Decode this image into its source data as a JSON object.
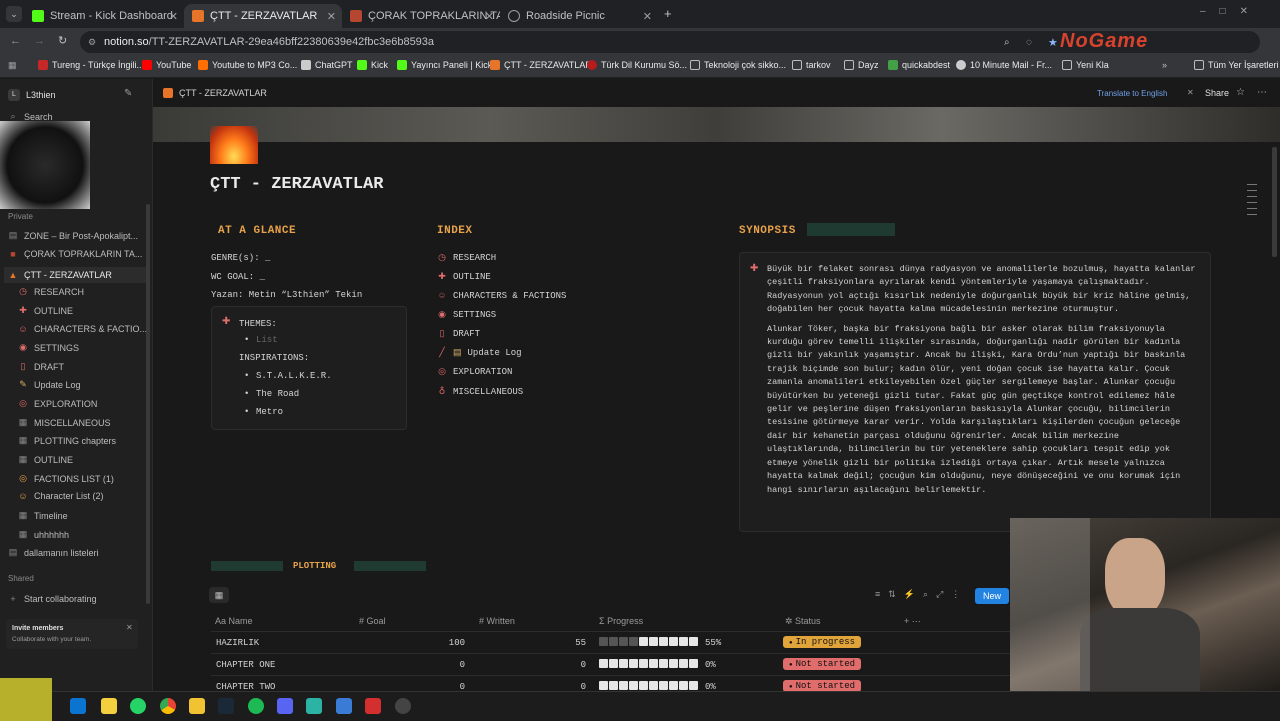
{
  "browser": {
    "tabs": [
      {
        "label": "Stream - Kick Dashboard",
        "color": "#53fc18"
      },
      {
        "label": "ÇTT - ZERZAVATLAR",
        "color": "#e8742a",
        "active": true
      },
      {
        "label": "ÇORAK TOPRAKLARIN TANRIL",
        "color": "#b5462f"
      },
      {
        "label": "Roadside Picnic",
        "color": "#9aa0a6"
      }
    ],
    "url_host": "notion.so",
    "url_path": "/TT-ZERZAVATLAR-29ea46bff22380639e42fbc3e6b8593a",
    "bookmarks": [
      {
        "label": "Tureng - Türkçe İngili...",
        "color": "#c62828"
      },
      {
        "label": "YouTube",
        "color": "#ff0000"
      },
      {
        "label": "Youtube to MP3 Co...",
        "color": "#ff6f00"
      },
      {
        "label": "ChatGPT",
        "color": "#cccccc"
      },
      {
        "label": "Kick",
        "color": "#53fc18"
      },
      {
        "label": "Yayıncı Paneli | Kick",
        "color": "#53fc18"
      },
      {
        "label": "ÇTT - ZERZAVATLAR",
        "color": "#e8742a"
      },
      {
        "label": "Türk Dil Kurumu Sö...",
        "color": "#b71c1c"
      },
      {
        "label": "Teknoloji çok sikko...",
        "color": "#888888"
      },
      {
        "label": "tarkov",
        "color": "#888888"
      },
      {
        "label": "Dayz",
        "color": "#888888"
      },
      {
        "label": "quickabdest",
        "color": "#43a047"
      },
      {
        "label": "10 Minute Mail - Fr...",
        "color": "#cccccc"
      },
      {
        "label": "Yeni Kla",
        "color": "#888888"
      },
      {
        "label": "Tüm Yer İşaretleri",
        "color": "#888888"
      }
    ],
    "watermark": "NoGame"
  },
  "sidebar": {
    "workspace": "L3thien",
    "search": "Search",
    "private_label": "Private",
    "items": [
      {
        "label": "ZONE – Bir Post-Apokalipt...",
        "icon": "page-icon"
      },
      {
        "label": "ÇORAK TOPRAKLARIN TA...",
        "icon": "book-icon"
      },
      {
        "label": "ÇTT - ZERZAVATLAR",
        "icon": "fire-icon"
      },
      {
        "label": "RESEARCH",
        "icon": "clock-icon"
      },
      {
        "label": "OUTLINE",
        "icon": "pin-icon"
      },
      {
        "label": "CHARACTERS & FACTIO...",
        "icon": "face-icon"
      },
      {
        "label": "SETTINGS",
        "icon": "location-icon"
      },
      {
        "label": "DRAFT",
        "icon": "bookmark-icon"
      },
      {
        "label": "Update Log",
        "icon": "memo-icon"
      },
      {
        "label": "EXPLORATION",
        "icon": "eye-icon"
      },
      {
        "label": "MISCELLANEOUS",
        "icon": "globe-icon"
      },
      {
        "label": "PLOTTING chapters",
        "icon": "table-icon"
      },
      {
        "label": "OUTLINE",
        "icon": "table-icon"
      },
      {
        "label": "FACTIONS LIST (1)",
        "icon": "eye-icon"
      },
      {
        "label": "Character List (2)",
        "icon": "face-icon"
      },
      {
        "label": "Timeline",
        "icon": "table-icon"
      },
      {
        "label": "uhhhhhh",
        "icon": "table-icon"
      },
      {
        "label": "dallamanın listeleri",
        "icon": "page-icon"
      }
    ],
    "shared_label": "Shared",
    "start_collab": "Start collaborating",
    "invite_title": "Invite members",
    "invite_sub": "Collaborate with your team."
  },
  "topbar": {
    "breadcrumb": "ÇTT - ZERZAVATLAR",
    "translate": "Translate to English",
    "share": "Share"
  },
  "page": {
    "title": "ÇTT - ZERZAVATLAR",
    "glance": {
      "heading": "AT A GLANCE",
      "genre": "GENRE(s): _",
      "wc_goal": "WC GOAL: _",
      "author": "Yazan: Metin “L3thien” Tekin",
      "themes_label": "THEMES:",
      "themes_placeholder": "List",
      "inspirations_label": "INSPIRATIONS:",
      "inspirations": [
        "S.T.A.L.K.E.R.",
        "The Road",
        "Metro"
      ]
    },
    "index": {
      "heading": "INDEX",
      "items": [
        {
          "label": "RESEARCH",
          "icon": "clock-icon"
        },
        {
          "label": "OUTLINE",
          "icon": "pin-icon"
        },
        {
          "label": "CHARACTERS & FACTIONS",
          "icon": "face-icon"
        },
        {
          "label": "SETTINGS",
          "icon": "location-icon"
        },
        {
          "label": "DRAFT",
          "icon": "bookmark-icon"
        },
        {
          "label": "Update Log",
          "icon": "memo-icon"
        },
        {
          "label": "EXPLORATION",
          "icon": "eye-icon"
        },
        {
          "label": "MISCELLANEOUS",
          "icon": "globe-icon"
        }
      ]
    },
    "synopsis": {
      "heading": "SYNOPSIS",
      "p1": "Büyük bir felaket sonrası dünya radyasyon ve anomalilerle bozulmuş, hayatta kalanlar çeşitli fraksiyonlara ayrılarak kendi yöntemleriyle yaşamaya çalışmaktadır. Radyasyonun yol açtığı kısırlık nedeniyle doğurganlık büyük bir kriz hâline gelmiş, doğabilen her çocuk hayatta kalma mücadelesinin merkezine oturmuştur.",
      "p2": "Alunkar Töker, başka bir fraksiyona bağlı bir asker olarak bilim fraksiyonuyla kurduğu görev temelli ilişkiler sırasında, doğurganlığı nadir görülen bir kadınla gizli bir yakınlık yaşamıştır. Ancak bu ilişki, Kara Ordu’nun yaptığı bir baskınla trajik biçimde son bulur; kadın ölür, yeni doğan çocuk ise hayatta kalır. Çocuk zamanla anomalileri etkileyebilen özel güçler sergilemeye başlar. Alunkar çocuğu büyütürken bu yeteneği gizli tutar. Fakat güç gün geçtikçe kontrol edilemez hâle gelir ve peşlerine düşen fraksiyonların baskısıyla Alunkar çocuğu, bilimcilerin tesisine götürmeye karar verir. Yolda karşılaştıkları kişilerden çocuğun geleceğe dair bir kehanetin parçası olduğunu öğrenirler. Ancak bilim merkezine ulaştıklarında, bilimcilerin bu tür yeteneklere sahip çocukları tespit edip yok etmeye yönelik gizli bir politika izlediği ortaya çıkar. Artık mesele yalnızca hayatta kalmak değil; çocuğun kim olduğunu, neye dönüşeceğini ve onu korumak için hangi sınırların aşılacağını belirlemektir."
    },
    "plotting": {
      "heading": "PLOTTING",
      "new_button": "New",
      "columns": [
        "Name",
        "Goal",
        "Written",
        "Progress",
        "Status"
      ],
      "rows": [
        {
          "name": "HAZIRLIK",
          "goal": "100",
          "written": "55",
          "progress": 0.55,
          "progress_text": "55%",
          "status": "In progress",
          "status_color": "#e0a43a"
        },
        {
          "name": "CHAPTER ONE",
          "goal": "0",
          "written": "0",
          "progress": 0,
          "progress_text": "0%",
          "status": "Not started",
          "status_color": "#e06c6c"
        },
        {
          "name": "CHAPTER TWO",
          "goal": "0",
          "written": "0",
          "progress": 0,
          "progress_text": "0%",
          "status": "Not started",
          "status_color": "#e06c6c"
        }
      ]
    }
  }
}
